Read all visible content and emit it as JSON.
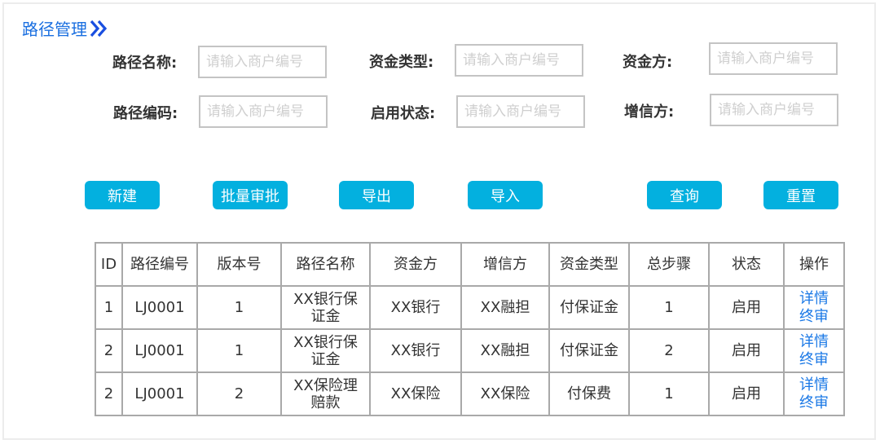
{
  "page": {
    "title": "路径管理",
    "title_icon": "double-chevron-right-icon",
    "accent_color": "#1a6fe0",
    "button_color": "#03b0df",
    "link_color": "#1a78e6"
  },
  "filters": [
    {
      "label": "路径名称:",
      "placeholder": "请输入商户编号",
      "value": ""
    },
    {
      "label": "资金类型:",
      "placeholder": "请输入商户编号",
      "value": ""
    },
    {
      "label": "资金方:",
      "placeholder": "请输入商户编号",
      "value": ""
    },
    {
      "label": "路径编码:",
      "placeholder": "请输入商户编号",
      "value": ""
    },
    {
      "label": "启用状态:",
      "placeholder": "请输入商户编号",
      "value": ""
    },
    {
      "label": "增信方:",
      "placeholder": "请输入商户编号",
      "value": ""
    }
  ],
  "toolbar": {
    "new_label": "新建",
    "batch_approve_label": "批量审批",
    "export_label": "导出",
    "import_label": "导入",
    "query_label": "查询",
    "reset_label": "重置"
  },
  "table": {
    "columns": [
      "ID",
      "路径编号",
      "版本号",
      "路径名称",
      "资金方",
      "增信方",
      "资金类型",
      "总步骤",
      "状态",
      "操作"
    ],
    "rows": [
      {
        "id": "1",
        "code": "LJ0001",
        "version": "1",
        "name": "XX银行保证金",
        "funder": "XX银行",
        "guarantor": "XX融担",
        "fund_type": "付保证金",
        "steps": "1",
        "status": "启用",
        "actions": [
          "详情",
          "终审"
        ]
      },
      {
        "id": "2",
        "code": "LJ0001",
        "version": "1",
        "name": "XX银行保证金",
        "funder": "XX银行",
        "guarantor": "XX融担",
        "fund_type": "付保证金",
        "steps": "2",
        "status": "启用",
        "actions": [
          "详情",
          "终审"
        ]
      },
      {
        "id": "2",
        "code": "LJ0001",
        "version": "2",
        "name": "XX保险理赔款",
        "funder": "XX保险",
        "guarantor": "XX保险",
        "fund_type": "付保费",
        "steps": "1",
        "status": "启用",
        "actions": [
          "详情",
          "终审"
        ]
      }
    ]
  }
}
